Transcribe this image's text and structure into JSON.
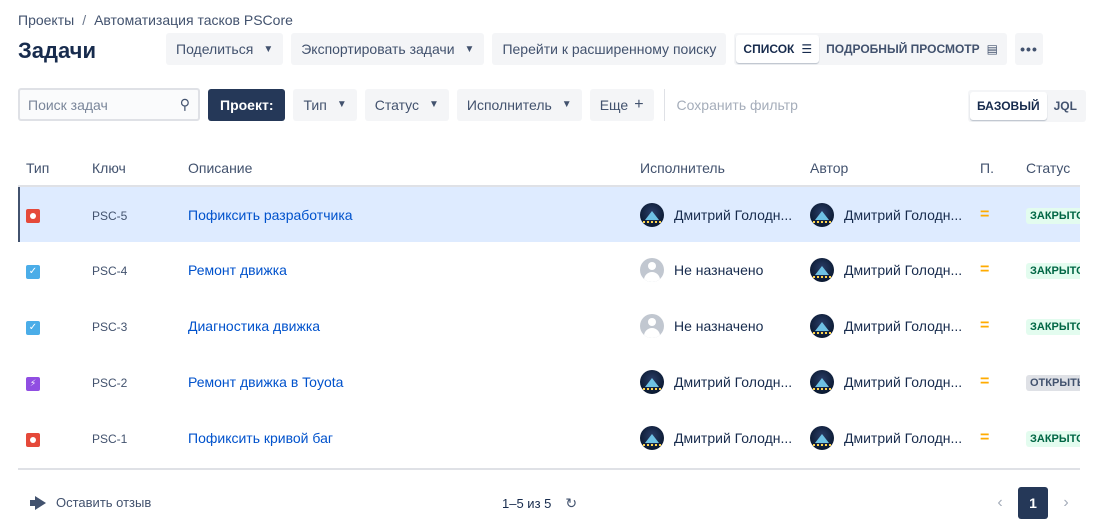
{
  "breadcrumb": {
    "root": "Проекты",
    "separator": "/",
    "project": "Автоматизация тасков PSCore"
  },
  "title": "Задачи",
  "toolbar": {
    "share": "Поделиться",
    "export": "Экспортировать задачи",
    "advanced_search": "Перейти к расширенному поиску",
    "view_list": "СПИСОК",
    "view_detail": "ПОДРОБНЫЙ ПРОСМОТР",
    "more": "•••"
  },
  "filters": {
    "search_placeholder": "Поиск задач",
    "project": "Проект:",
    "type": "Тип",
    "status": "Статус",
    "assignee": "Исполнитель",
    "more": "Еще",
    "save_filter": "Сохранить фильтр",
    "mode_basic": "БАЗОВЫЙ",
    "mode_jql": "JQL"
  },
  "table": {
    "columns": {
      "type": "Тип",
      "key": "Ключ",
      "summary": "Описание",
      "assignee": "Исполнитель",
      "reporter": "Автор",
      "priority": "П.",
      "status": "Статус"
    },
    "rows": [
      {
        "type": "bug",
        "key": "PSC-5",
        "summary": "Пофиксить разработчика",
        "assignee": "Дмитрий Голодн...",
        "assignee_avatar": true,
        "reporter": "Дмитрий Голодн...",
        "priority": "=",
        "status": "ЗАКРЫТО",
        "status_kind": "done",
        "selected": true
      },
      {
        "type": "task",
        "key": "PSC-4",
        "summary": "Ремонт движка",
        "assignee": "Не назначено",
        "assignee_avatar": false,
        "reporter": "Дмитрий Голодн...",
        "priority": "=",
        "status": "ЗАКРЫТО",
        "status_kind": "done",
        "selected": false
      },
      {
        "type": "task",
        "key": "PSC-3",
        "summary": "Диагностика движка",
        "assignee": "Не назначено",
        "assignee_avatar": false,
        "reporter": "Дмитрий Голодн...",
        "priority": "=",
        "status": "ЗАКРЫТО",
        "status_kind": "done",
        "selected": false
      },
      {
        "type": "epic",
        "key": "PSC-2",
        "summary": "Ремонт движка в Toyota",
        "assignee": "Дмитрий Голодн...",
        "assignee_avatar": true,
        "reporter": "Дмитрий Голодн...",
        "priority": "=",
        "status": "ОТКРЫТЬ",
        "status_kind": "open",
        "selected": false
      },
      {
        "type": "bug",
        "key": "PSC-1",
        "summary": "Пофиксить кривой баг",
        "assignee": "Дмитрий Голодн...",
        "assignee_avatar": true,
        "reporter": "Дмитрий Голодн...",
        "priority": "=",
        "status": "ЗАКРЫТО",
        "status_kind": "done",
        "selected": false
      }
    ]
  },
  "footer": {
    "feedback": "Оставить отзыв",
    "count": "1–5 из 5",
    "page": "1"
  },
  "colors": {
    "primary_dark": "#253858",
    "link": "#0052cc",
    "selected_row": "#deebff",
    "priority_medium": "#ffab00",
    "status_done_bg": "#e3fcef"
  },
  "icons": {
    "bug": "bug-icon",
    "task": "task-check-icon",
    "epic": "epic-lightning-icon",
    "search": "search-icon",
    "refresh": "refresh-icon",
    "feedback": "megaphone-icon"
  }
}
